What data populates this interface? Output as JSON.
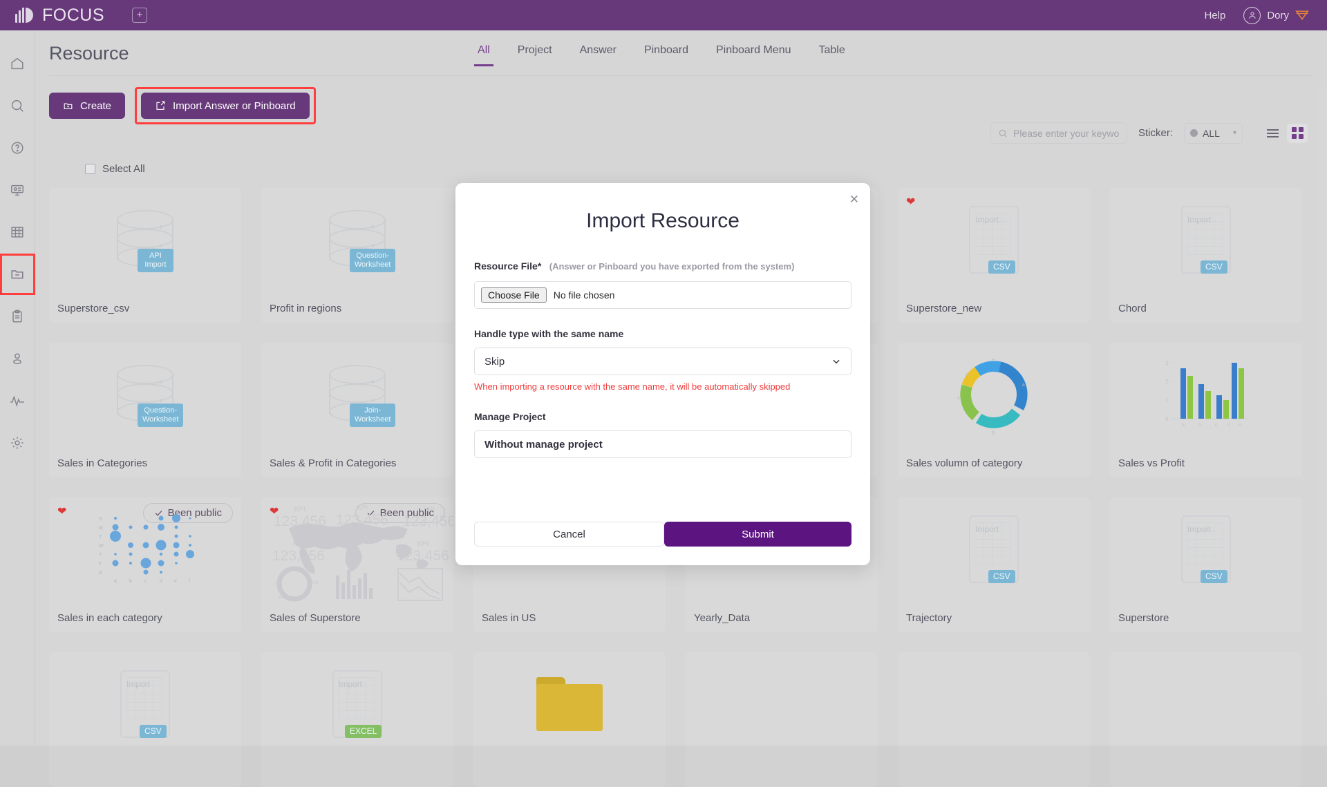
{
  "topbar": {
    "brand": "FOCUS",
    "add_tab_icon": "plus-square-icon",
    "help": "Help",
    "user": "Dory",
    "avatar_icon": "user-circle-icon",
    "badge_icon": "diamond-badge-icon",
    "bg": "#4a1461"
  },
  "sidebar": {
    "items": [
      {
        "name": "home",
        "icon": "home-icon"
      },
      {
        "name": "search",
        "icon": "search-icon"
      },
      {
        "name": "help",
        "icon": "question-circle-icon"
      },
      {
        "name": "presentation",
        "icon": "presentation-icon"
      },
      {
        "name": "table",
        "icon": "grid-table-icon"
      },
      {
        "name": "resource",
        "icon": "folder-minus-icon",
        "selected": true
      },
      {
        "name": "clipboard",
        "icon": "clipboard-icon"
      },
      {
        "name": "user",
        "icon": "person-icon"
      },
      {
        "name": "monitor",
        "icon": "pulse-icon"
      },
      {
        "name": "settings",
        "icon": "gear-icon"
      }
    ],
    "highlight_color": "#ff1a1a"
  },
  "page": {
    "title": "Resource",
    "tabs": [
      {
        "label": "All",
        "active": true
      },
      {
        "label": "Project",
        "active": false
      },
      {
        "label": "Answer",
        "active": false
      },
      {
        "label": "Pinboard",
        "active": false
      },
      {
        "label": "Pinboard Menu",
        "active": false
      },
      {
        "label": "Table",
        "active": false
      }
    ],
    "create_button": "Create",
    "import_button": "Import Answer or Pinboard",
    "select_all": "Select All",
    "accent": "#4a1461"
  },
  "search": {
    "placeholder": "Please enter your keywo",
    "value": "",
    "icon": "search-icon"
  },
  "sticker": {
    "label": "Sticker:",
    "value": "ALL",
    "caret_icon": "chevron-down-icon"
  },
  "view": {
    "list_icon": "list-view-icon",
    "grid_icon": "grid-view-icon",
    "active": "grid"
  },
  "cards": [
    {
      "name": "Superstore_csv",
      "thumb": "database",
      "tag": "API Import",
      "tag_color": "blue",
      "favorite": false,
      "public": false
    },
    {
      "name": "Profit in regions",
      "thumb": "database",
      "tag": "Question-\nWorksheet",
      "tag_color": "blue",
      "favorite": false,
      "public": false
    },
    {
      "name": "",
      "thumb": "kpi",
      "tag": "",
      "tag_color": "",
      "favorite": true,
      "public": false
    },
    {
      "name": "",
      "thumb": "blank",
      "tag": "",
      "tag_color": "",
      "favorite": false,
      "public": false
    },
    {
      "name": "Superstore_new",
      "thumb": "sheet",
      "tag": "CSV",
      "tag_color": "blue",
      "favorite": true,
      "public": false
    },
    {
      "name": "Chord",
      "thumb": "sheet",
      "tag": "CSV",
      "tag_color": "blue",
      "favorite": false,
      "public": false
    },
    {
      "name": "Sales in Categories",
      "thumb": "database",
      "tag": "Question-\nWorksheet",
      "tag_color": "blue",
      "favorite": false,
      "public": false
    },
    {
      "name": "Sales & Profit in Categories",
      "thumb": "database",
      "tag": "Join-\nWorksheet",
      "tag_color": "blue",
      "favorite": false,
      "public": false
    },
    {
      "name": "",
      "thumb": "blank",
      "tag": "",
      "tag_color": "",
      "favorite": false,
      "public": false
    },
    {
      "name": "",
      "thumb": "blank",
      "tag": "",
      "tag_color": "",
      "favorite": false,
      "public": false
    },
    {
      "name": "Sales volumn of category",
      "thumb": "donut",
      "tag": "",
      "tag_color": "",
      "favorite": false,
      "public": false
    },
    {
      "name": "Sales vs Profit",
      "thumb": "bars",
      "tag": "",
      "tag_color": "",
      "favorite": false,
      "public": false
    },
    {
      "name": "Sales in each category",
      "thumb": "bubble",
      "tag": "",
      "tag_color": "",
      "favorite": true,
      "public": true
    },
    {
      "name": "Sales of Superstore",
      "thumb": "dashboard",
      "tag": "",
      "tag_color": "",
      "favorite": true,
      "public": true
    },
    {
      "name": "Sales in US",
      "thumb": "blank",
      "tag": "",
      "tag_color": "",
      "favorite": false,
      "public": false
    },
    {
      "name": "Yearly_Data",
      "thumb": "blank",
      "tag": "",
      "tag_color": "",
      "favorite": false,
      "public": false
    },
    {
      "name": "Trajectory",
      "thumb": "sheet",
      "tag": "CSV",
      "tag_color": "blue",
      "favorite": false,
      "public": false
    },
    {
      "name": "Superstore",
      "thumb": "sheet",
      "tag": "CSV",
      "tag_color": "blue",
      "favorite": false,
      "public": false
    },
    {
      "name": "",
      "thumb": "sheet",
      "tag": "CSV",
      "tag_color": "blue",
      "favorite": false,
      "public": false
    },
    {
      "name": "",
      "thumb": "sheet",
      "tag": "EXCEL",
      "tag_color": "green",
      "favorite": false,
      "public": false
    },
    {
      "name": "",
      "thumb": "folder",
      "tag": "",
      "tag_color": "",
      "favorite": false,
      "public": false
    },
    {
      "name": "",
      "thumb": "blank",
      "tag": "",
      "tag_color": "",
      "favorite": false,
      "public": false
    },
    {
      "name": "",
      "thumb": "blank",
      "tag": "",
      "tag_color": "",
      "favorite": false,
      "public": false
    },
    {
      "name": "",
      "thumb": "blank",
      "tag": "",
      "tag_color": "",
      "favorite": false,
      "public": false
    }
  ],
  "card_badges": {
    "public_label": "Been public",
    "check_icon": "check-icon",
    "heart_icon": "heart-icon"
  },
  "kpi_thumb": {
    "kpi_label": "KPI",
    "kpi_value": "123,456"
  },
  "modal": {
    "title": "Import Resource",
    "close_icon": "close-icon",
    "file_label": "Resource File",
    "required_mark": "*",
    "file_hint": "(Answer or Pinboard you have exported from the system)",
    "choose_file_button": "Choose File",
    "no_file_text": "No file chosen",
    "handle_label": "Handle type with the same name",
    "handle_value": "Skip",
    "handle_caret_icon": "chevron-down-icon",
    "handle_warning": "When importing a resource with the same name, it will be automatically skipped",
    "warning_color": "#ef3b3b",
    "project_label": "Manage Project",
    "project_value": "Without manage project",
    "cancel_button": "Cancel",
    "submit_button": "Submit",
    "submit_color": "#5b1480"
  }
}
